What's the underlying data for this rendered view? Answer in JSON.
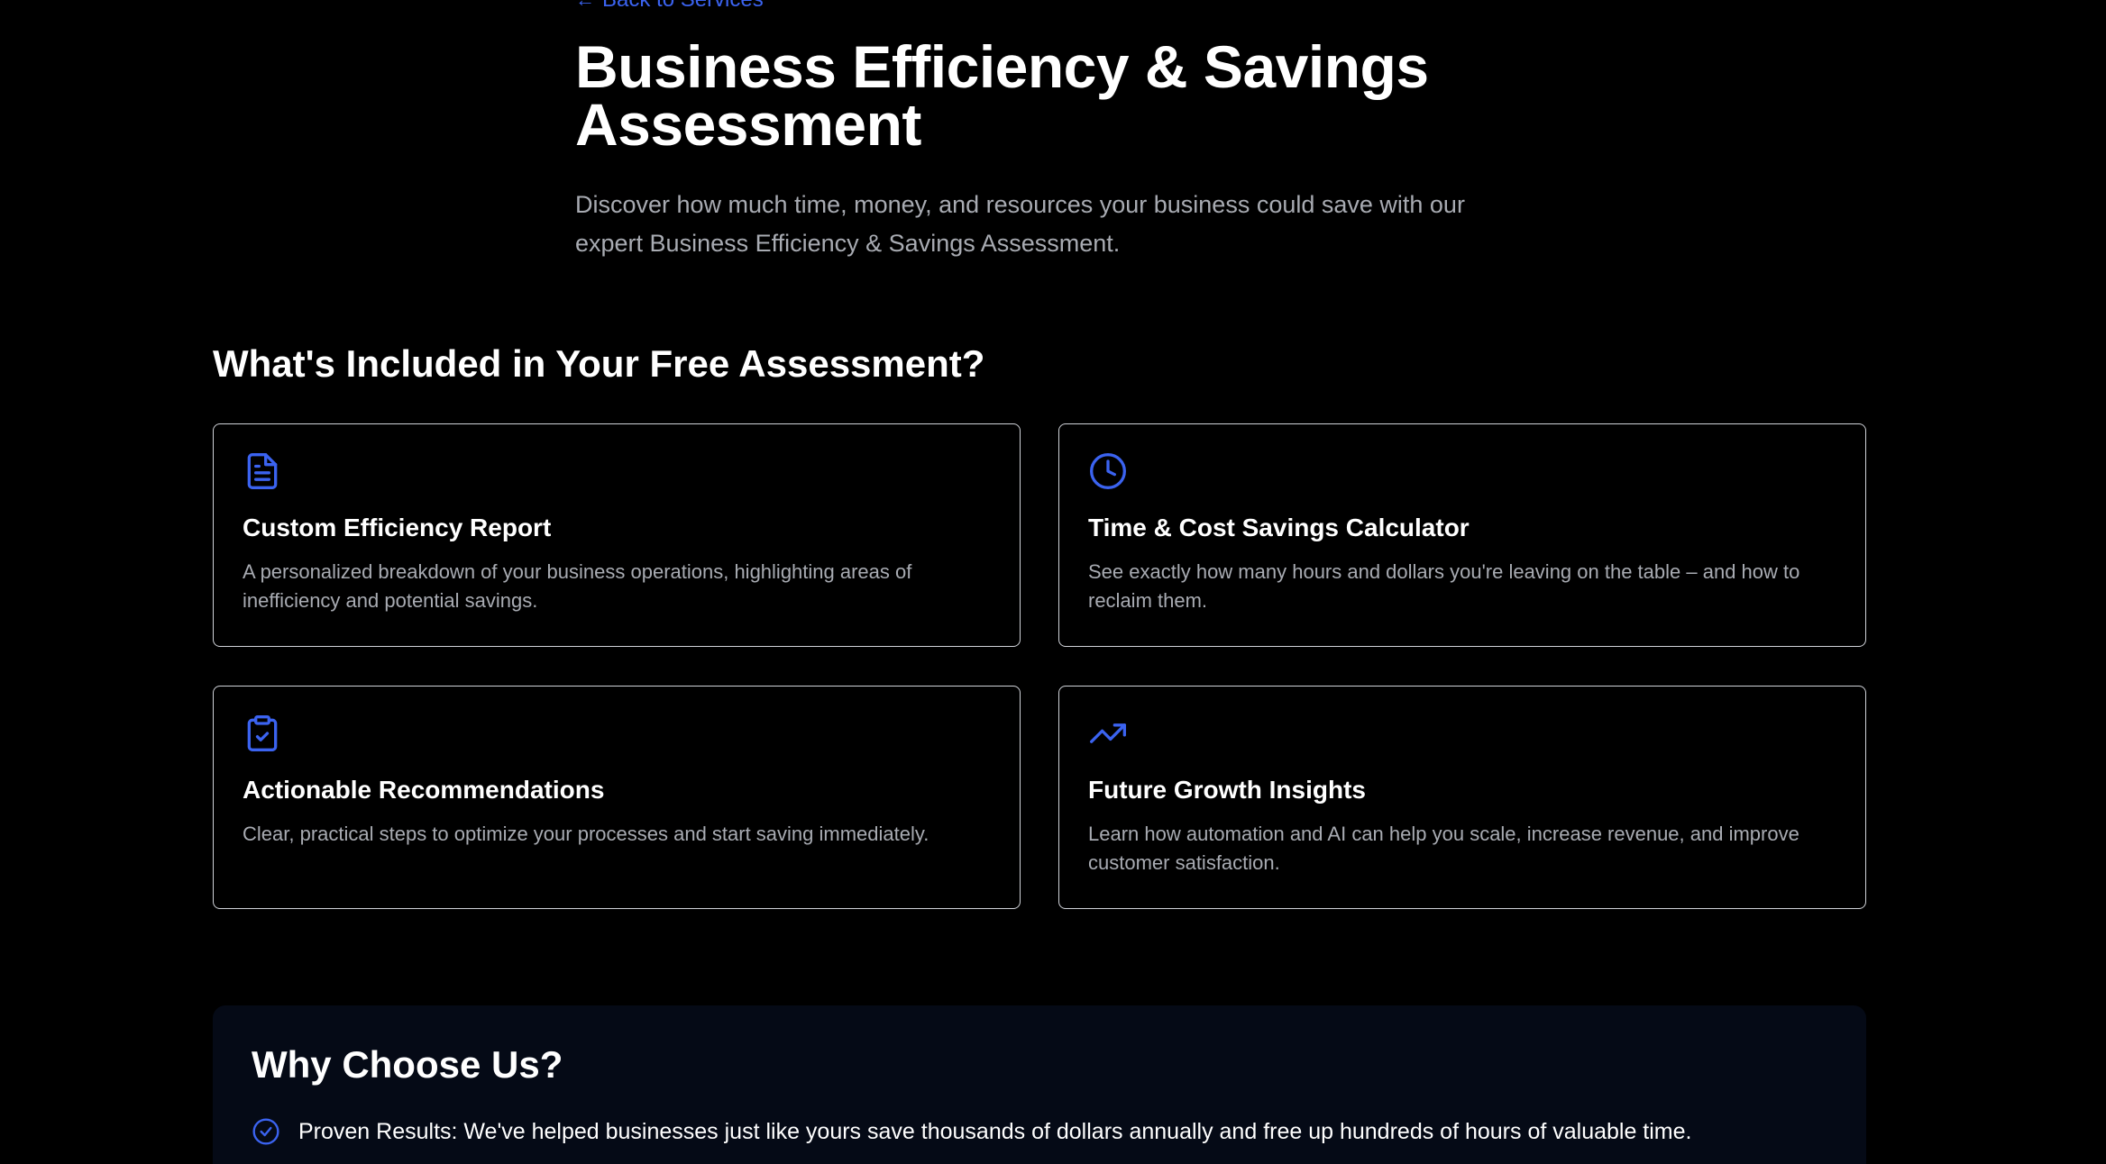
{
  "hero": {
    "back_label": "Back to Services",
    "title": "Business Efficiency & Savings Assessment",
    "subtitle": "Discover how much time, money, and resources your business could save with our expert Business Efficiency & Savings Assessment."
  },
  "included": {
    "heading": "What's Included in Your Free Assessment?",
    "cards": [
      {
        "icon": "document-icon",
        "title": "Custom Efficiency Report",
        "description": "A personalized breakdown of your business operations, highlighting areas of inefficiency and potential savings."
      },
      {
        "icon": "clock-icon",
        "title": "Time & Cost Savings Calculator",
        "description": "See exactly how many hours and dollars you're leaving on the table – and how to reclaim them."
      },
      {
        "icon": "clipboard-check-icon",
        "title": "Actionable Recommendations",
        "description": "Clear, practical steps to optimize your processes and start saving immediately."
      },
      {
        "icon": "trending-up-icon",
        "title": "Future Growth Insights",
        "description": "Learn how automation and AI can help you scale, increase revenue, and improve customer satisfaction."
      }
    ]
  },
  "why": {
    "heading": "Why Choose Us?",
    "items": [
      {
        "icon": "check-circle-icon",
        "text": "Proven Results: We've helped businesses just like yours save thousands of dollars annually and free up hundreds of hours of valuable time."
      }
    ]
  },
  "colors": {
    "background": "#000000",
    "accent": "#3b63f0",
    "muted_text": "#a8abb2",
    "card_border": "#d0d3d9",
    "panel_bg": "#050a16"
  }
}
